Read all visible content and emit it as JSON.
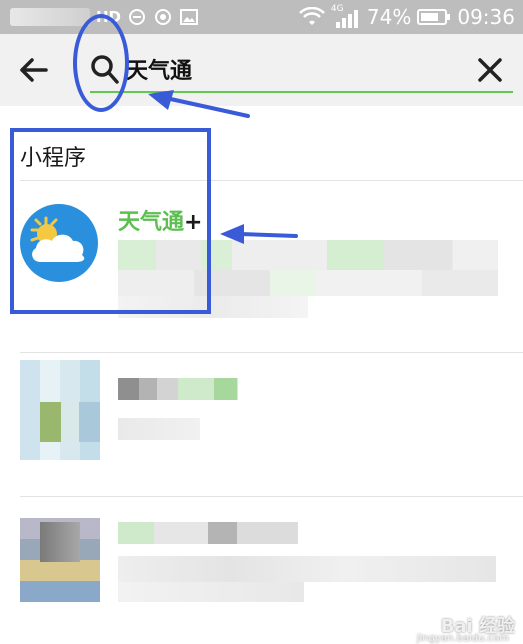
{
  "status_bar": {
    "carrier": "HD",
    "network": "4G",
    "battery_percent": "74%",
    "time": "09:36"
  },
  "search": {
    "query": "天气通",
    "back_icon": "arrow-left-icon",
    "search_icon": "magnifier-icon",
    "clear_icon": "close-icon"
  },
  "results": {
    "section_title": "小程序",
    "mini_program": {
      "name": "天气通",
      "name_suffix": "+"
    }
  },
  "watermark": {
    "brand": "Bai 经验",
    "url": "jingyan.baidu.com"
  },
  "colors": {
    "accent_green": "#5cbf50",
    "annotation_blue": "#3a5bd8",
    "status_bar": "#bdbdbd",
    "search_bg": "#f1f1f1"
  }
}
